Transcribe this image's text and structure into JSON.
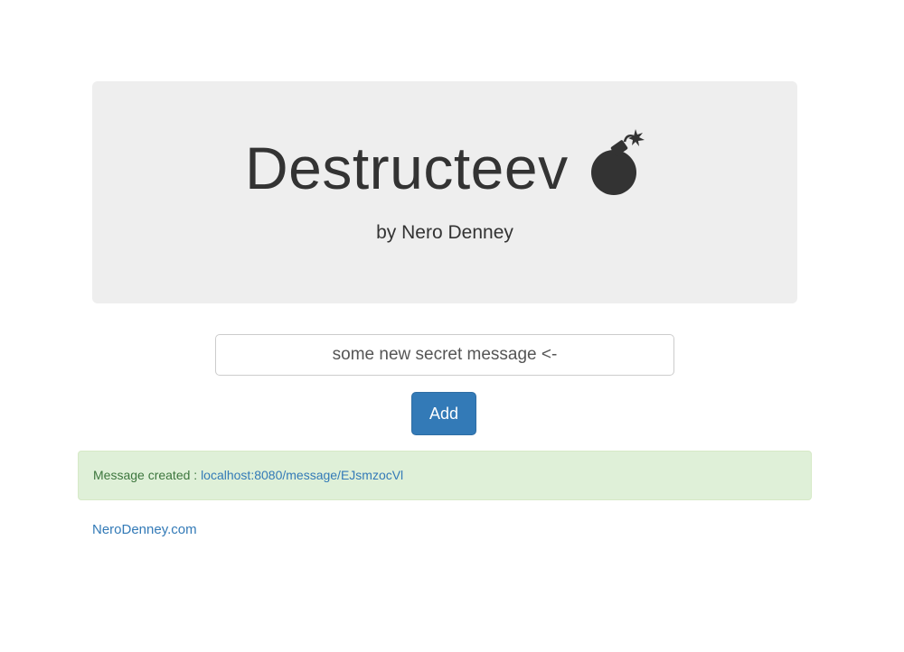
{
  "header": {
    "title": "Destructeev",
    "bomb_icon": "bomb-icon",
    "subtitle": "by Nero Denney"
  },
  "form": {
    "message_value": "some new secret message <-",
    "add_label": "Add"
  },
  "alert": {
    "prefix": "Message created :",
    "link_text": "localhost:8080/message/EJsmzocVl"
  },
  "footer": {
    "link_text": "NeroDenney.com"
  },
  "colors": {
    "jumbotron_bg": "#eeeeee",
    "button_primary": "#337ab7",
    "alert_success_bg": "#dff0d8",
    "alert_success_text": "#3c763d",
    "link": "#337ab7"
  }
}
